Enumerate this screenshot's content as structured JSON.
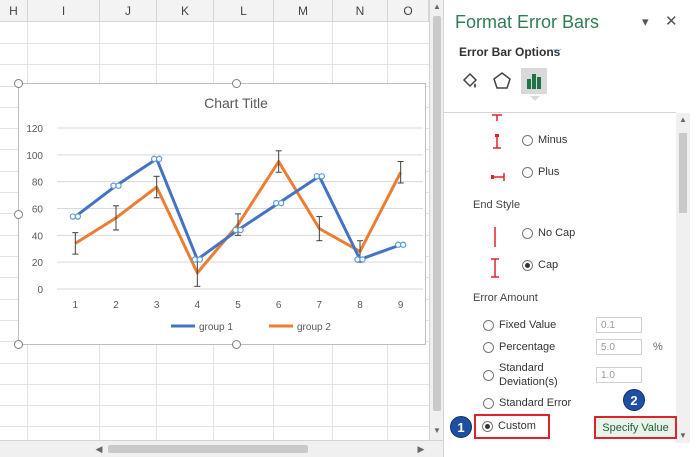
{
  "sheet": {
    "columns": [
      "H",
      "I",
      "J",
      "K",
      "L",
      "M",
      "N",
      "O"
    ]
  },
  "chart_data": {
    "type": "line",
    "title": "Chart Title",
    "categories": [
      "1",
      "2",
      "3",
      "4",
      "5",
      "6",
      "7",
      "8",
      "9"
    ],
    "ylim": [
      0,
      120
    ],
    "yticks": [
      "0",
      "20",
      "40",
      "60",
      "80",
      "100",
      "120"
    ],
    "grid": true,
    "legend_position": "bottom",
    "series": [
      {
        "name": "group 1",
        "color": "#4472c4",
        "values": [
          54,
          77,
          97,
          22,
          44,
          64,
          84,
          22,
          33
        ]
      },
      {
        "name": "group 2",
        "color": "#ed7d31",
        "values": [
          34,
          53,
          76,
          12,
          48,
          95,
          45,
          28,
          87
        ],
        "error": [
          8,
          9,
          8,
          10,
          8,
          8,
          9,
          8,
          8
        ]
      }
    ]
  },
  "pane": {
    "title": "Format Error Bars",
    "options_label": "Error Bar Options",
    "tab_icons": [
      "fill-line-icon",
      "effects-icon",
      "bar-options-icon"
    ],
    "direction_options": [
      {
        "label": "Minus",
        "checked": false
      },
      {
        "label": "Plus",
        "checked": false
      }
    ],
    "end_style_label": "End Style",
    "end_style_options": [
      {
        "label": "No Cap",
        "checked": false
      },
      {
        "label": "Cap",
        "checked": true
      }
    ],
    "error_amount_label": "Error Amount",
    "fixed_value": {
      "label": "Fixed Value",
      "value": "0.1"
    },
    "percentage": {
      "label": "Percentage",
      "value": "5.0",
      "unit": "%"
    },
    "std_dev": {
      "label_line1": "Standard",
      "label_line2": "Deviation(s)",
      "value": "1.0"
    },
    "std_error": {
      "label": "Standard Error"
    },
    "custom": {
      "label": "Custom",
      "checked": true
    },
    "specify_button": "Specify Value",
    "badges": [
      "1",
      "2"
    ]
  }
}
